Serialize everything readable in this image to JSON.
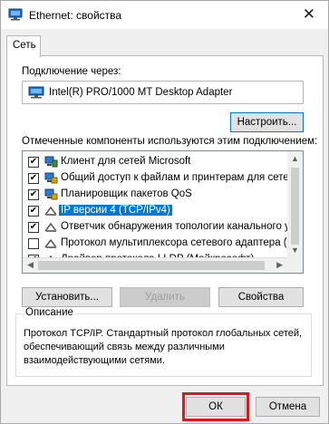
{
  "window": {
    "title": "Ethernet: свойства",
    "close_glyph": "✕"
  },
  "tabs": [
    {
      "label": "Сеть"
    }
  ],
  "connection": {
    "label": "Подключение через:",
    "adapter": "Intel(R) PRO/1000 MT Desktop Adapter",
    "configure_button": "Настроить..."
  },
  "components": {
    "label": "Отмеченные компоненты используются этим подключением:",
    "items": [
      {
        "checked": true,
        "label": "Клиент для сетей Microsoft",
        "icon": "network-client-icon"
      },
      {
        "checked": true,
        "label": "Общий доступ к файлам и принтерам для сетей Mi",
        "icon": "network-service-icon"
      },
      {
        "checked": true,
        "label": "Планировщик пакетов QoS",
        "icon": "network-service-icon"
      },
      {
        "checked": true,
        "label": "IP версии 4 (TCP/IPv4)",
        "icon": "network-protocol-icon",
        "selected": true
      },
      {
        "checked": false,
        "label": "Ответчик обнаружения топологии канального уров",
        "icon": "network-protocol-icon"
      },
      {
        "checked": false,
        "label": "Протокол мультиплексора сетевого адаптера (Майк",
        "icon": "network-protocol-icon"
      },
      {
        "checked": true,
        "label": "Драйвер протокола LLDP (Майкрософт)",
        "icon": "network-protocol-icon"
      }
    ]
  },
  "actions": {
    "install": "Установить...",
    "remove": "Удалить",
    "properties": "Свойства"
  },
  "description": {
    "title": "Описание",
    "text": "Протокол TCP/IP. Стандартный протокол глобальных сетей, обеспечивающий связь между различными взаимодействующими сетями."
  },
  "footer": {
    "ok": "ОК",
    "cancel": "Отмена"
  },
  "colors": {
    "selection": "#0078d7",
    "highlight_box": "#e0161b",
    "checkmark": "#000000"
  }
}
